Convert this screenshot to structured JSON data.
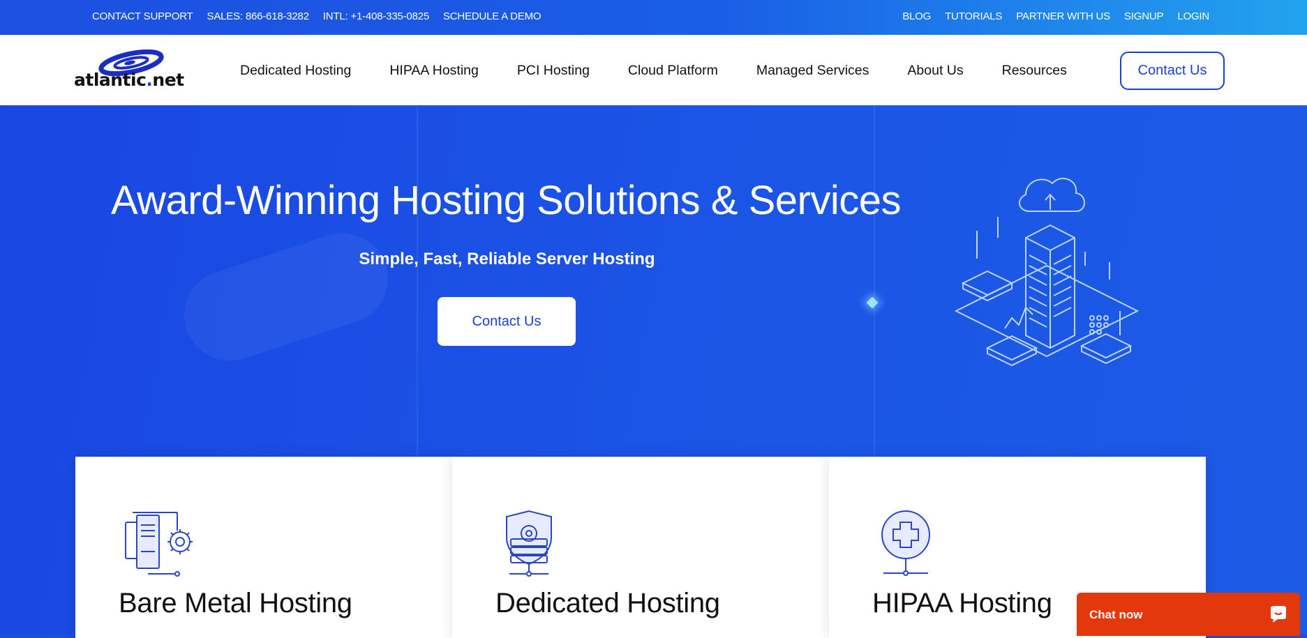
{
  "topbar": {
    "left": [
      "CONTACT SUPPORT",
      "SALES: 866-618-3282",
      "INTL: +1-408-335-0825",
      "SCHEDULE A DEMO"
    ],
    "right": [
      "BLOG",
      "TUTORIALS",
      "PARTNER WITH US",
      "SIGNUP",
      "LOGIN"
    ]
  },
  "header": {
    "logo": {
      "part1": "atlantic",
      "dot": ".",
      "part2": "net"
    },
    "nav": [
      "Dedicated Hosting",
      "HIPAA Hosting",
      "PCI Hosting",
      "Cloud Platform",
      "Managed Services",
      "About Us",
      "Resources"
    ],
    "contact_label": "Contact Us"
  },
  "hero": {
    "title": "Award-Winning Hosting Solutions & Services",
    "subtitle": "Simple, Fast, Reliable Server Hosting",
    "cta_label": "Contact Us"
  },
  "cards": [
    {
      "title": "Bare Metal Hosting",
      "icon": "server-gear-icon"
    },
    {
      "title": "Dedicated Hosting",
      "icon": "shield-server-icon"
    },
    {
      "title": "HIPAA Hosting",
      "icon": "medical-cross-icon"
    }
  ],
  "chat": {
    "label": "Chat now",
    "icon": "chat-bubble-icon"
  },
  "colors": {
    "brand_blue": "#1a3fd1",
    "hero_bg": "#1b50e4",
    "chat_orange": "#e2380b"
  }
}
